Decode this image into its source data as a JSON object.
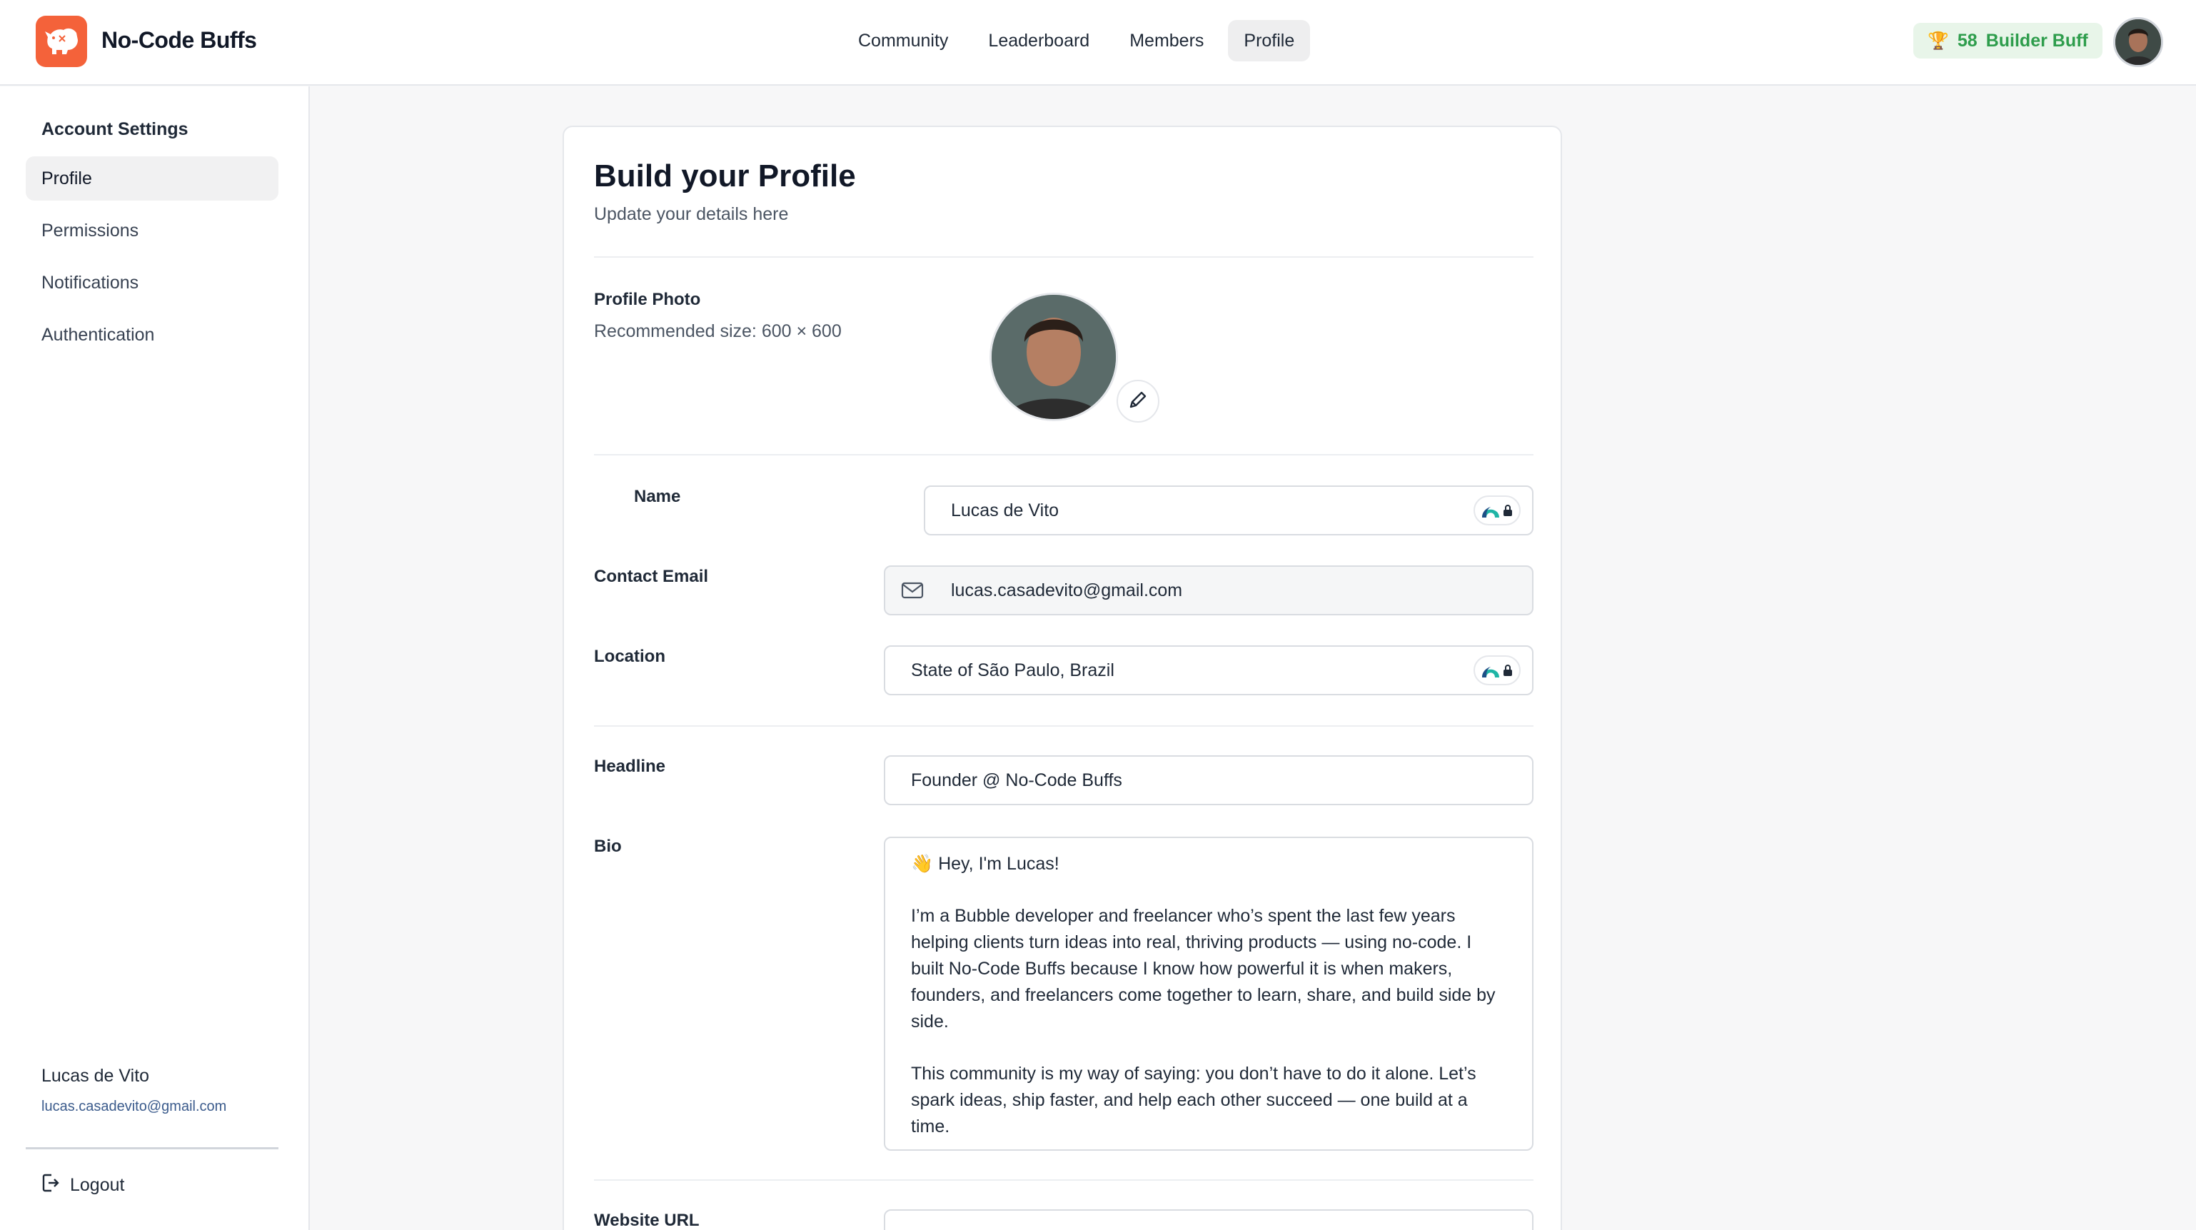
{
  "app": {
    "brand": "No-Code Buffs"
  },
  "nav": {
    "items": [
      "Community",
      "Leaderboard",
      "Members",
      "Profile"
    ],
    "active": "Profile"
  },
  "badge": {
    "points": "58",
    "title": "Builder Buff"
  },
  "sidebar": {
    "heading": "Account Settings",
    "items": [
      "Profile",
      "Permissions",
      "Notifications",
      "Authentication"
    ],
    "user_name": "Lucas de Vito",
    "user_email": "lucas.casadevito@gmail.com",
    "logout_label": "Logout"
  },
  "form": {
    "title": "Build your Profile",
    "subtitle": "Update your details here",
    "photo_label": "Profile Photo",
    "photo_hint": "Recommended size: 600 × 600",
    "name_label": "Name",
    "name_value": "Lucas de Vito",
    "email_label": "Contact Email",
    "email_value": "lucas.casadevito@gmail.com",
    "location_label": "Location",
    "location_value": "State of São Paulo, Brazil",
    "headline_label": "Headline",
    "headline_value": "Founder @ No-Code Buffs",
    "bio_label": "Bio",
    "bio_p1": "👋 Hey, I'm Lucas!",
    "bio_p2": "I’m a Bubble developer and freelancer who’s spent the last few years helping clients turn ideas into real, thriving products — using no-code. I built No-Code Buffs because I know how powerful it is when makers, founders, and freelancers come together to learn, share, and build side by side.",
    "bio_p3": "This community is my way of saying: you don’t have to do it alone. Let’s spark ideas, ship faster, and help each other succeed — one build at a time.",
    "website_label": "Website URL"
  },
  "colors": {
    "brand_orange": "#f4623a",
    "badge_green": "#2e9d4c",
    "link_blue": "#3b5b8c"
  }
}
